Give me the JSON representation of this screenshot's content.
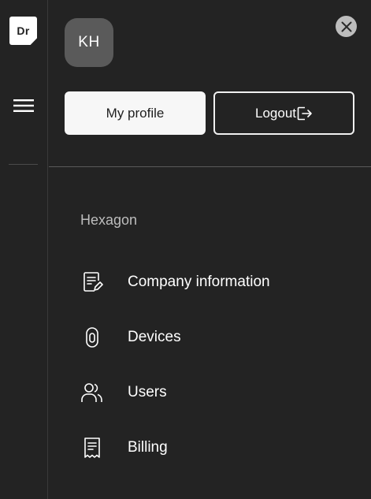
{
  "rail": {
    "logo_text": "Dr",
    "menu_icon": "hamburger-icon"
  },
  "panel": {
    "close_icon": "close-icon",
    "avatar_initials": "KH",
    "profile_button_label": "My profile",
    "logout_button_label": "Logout",
    "logout_icon": "logout-icon",
    "organization_name": "Hexagon"
  },
  "menu": {
    "items": [
      {
        "label": "Company information",
        "icon": "document-edit-icon"
      },
      {
        "label": "Devices",
        "icon": "device-icon"
      },
      {
        "label": "Users",
        "icon": "users-icon"
      },
      {
        "label": "Billing",
        "icon": "receipt-icon"
      }
    ]
  },
  "colors": {
    "background": "#232323",
    "primary_button_bg": "#f7f7f7",
    "avatar_bg": "#5a5a5a",
    "muted_text": "#bdbdbd"
  }
}
